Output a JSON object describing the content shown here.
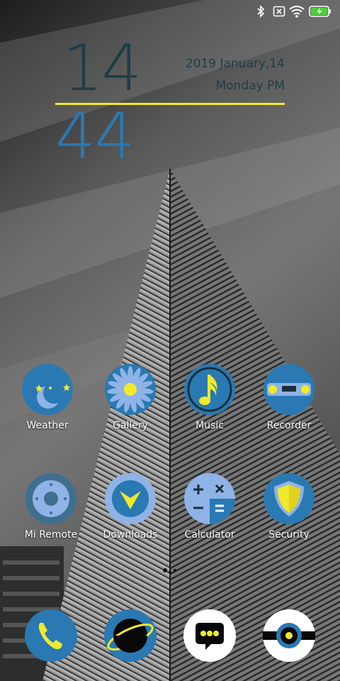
{
  "status_bar": {
    "icons": [
      "bluetooth-icon",
      "no-sim-icon",
      "wifi-icon",
      "battery-charging-icon"
    ]
  },
  "clock": {
    "hour": "14",
    "minute": "44",
    "date": "2019  January,14",
    "day": "Monday  PM"
  },
  "colors": {
    "accent_blue": "#2a79b3",
    "accent_yellow": "#f0ea2b",
    "clock_dark": "#1f3c46",
    "light_blue": "#8fb3e6"
  },
  "apps": {
    "row1": [
      {
        "label": "Weather",
        "icon": "weather-moon-icon"
      },
      {
        "label": "Gallery",
        "icon": "gallery-flower-icon"
      },
      {
        "label": "Music",
        "icon": "music-note-icon"
      },
      {
        "label": "Recorder",
        "icon": "recorder-icon"
      }
    ],
    "row2": [
      {
        "label": "Mi Remote",
        "icon": "mi-remote-icon"
      },
      {
        "label": "Downloads",
        "icon": "downloads-icon"
      },
      {
        "label": "Calculator",
        "icon": "calculator-icon"
      },
      {
        "label": "Security",
        "icon": "security-shield-icon"
      }
    ]
  },
  "dock": [
    {
      "icon": "phone-icon"
    },
    {
      "icon": "browser-planet-icon"
    },
    {
      "icon": "messaging-icon"
    },
    {
      "icon": "camera-icon"
    }
  ]
}
